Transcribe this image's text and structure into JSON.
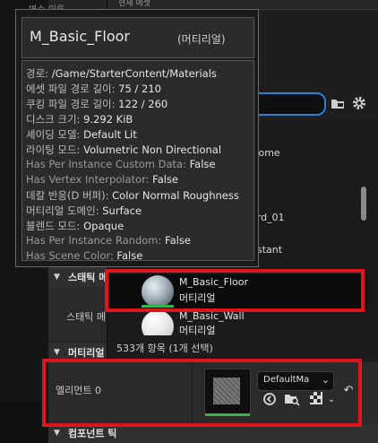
{
  "top_left_label": "변수 이름",
  "picker": {
    "header": "현재 에셋",
    "list_fragments": [
      "Dome",
      "h",
      "ard_01",
      "nstant"
    ],
    "selected": {
      "name": "M_Basic_Floor",
      "type": "머티리얼"
    },
    "next": {
      "name": "M_Basic_Wall",
      "type": "머티리얼"
    },
    "status": "533개 항목 (1개 선택)"
  },
  "tooltip": {
    "title": "M_Basic_Floor",
    "subtitle": "(머티리얼)",
    "lines": [
      {
        "k": "경로: ",
        "v": "/Game/StarterContent/Materials"
      },
      {
        "k": "에셋 파일 경로 길이: ",
        "v": "75 / 210"
      },
      {
        "k": "쿠킹 파일 경로 길이: ",
        "v": "122 / 260"
      },
      {
        "k": "디스크 크기: ",
        "v": "9.292 KiB"
      },
      {
        "k": "셰이딩 모델: ",
        "v": "Default Lit"
      },
      {
        "k": "라이팅 모드: ",
        "v": "Volumetric Non Directional"
      },
      {
        "k": "Has Per Instance Custom Data: ",
        "v": "False"
      },
      {
        "k": "Has Vertex Interpolator: ",
        "v": "False"
      },
      {
        "k": "데칼 반응(D 버퍼): ",
        "v": "Color Normal Roughness"
      },
      {
        "k": "머티리얼 도메인: ",
        "v": "Surface"
      },
      {
        "k": "블렌드 모드: ",
        "v": "Opaque"
      },
      {
        "k": "Has Per Instance Random: ",
        "v": "False"
      },
      {
        "k": "Has Scene Color: ",
        "v": "False"
      }
    ]
  },
  "categories": {
    "static_mesh_short": "스태틱 메",
    "static_mesh_label": "스태틱 메",
    "materials": "머티리얼",
    "component_tick": "컴포넌트 틱"
  },
  "element": {
    "label": "엘리먼트 0",
    "dropdown_value": "DefaultMa",
    "dropdown_chevron": "⌄",
    "reset_icon_glyph": "↶"
  },
  "colors": {
    "selection_outline": "#e0141b",
    "search_focus": "#2a7fd3",
    "asset_loaded_bar": "#37b24d"
  }
}
